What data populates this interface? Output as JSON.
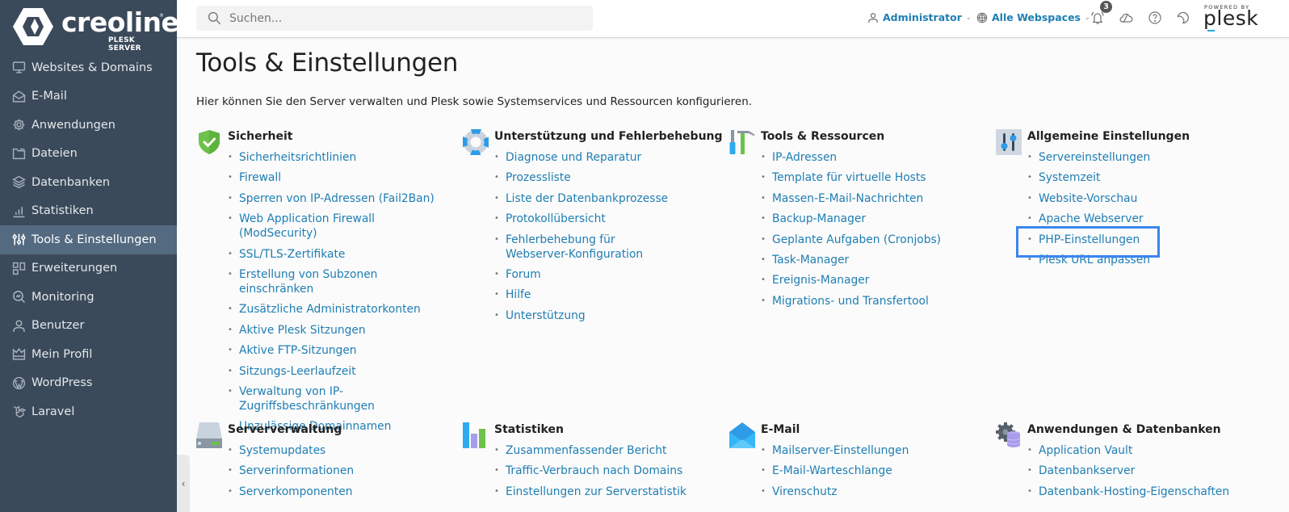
{
  "brand": {
    "name": "creoline",
    "subtitle": "PLESK SERVER",
    "registered": "®"
  },
  "sidebar": {
    "items": [
      {
        "label": "Websites & Domains",
        "icon": "monitor-icon",
        "active": false
      },
      {
        "label": "E-Mail",
        "icon": "mail-open-icon",
        "active": false
      },
      {
        "label": "Anwendungen",
        "icon": "gear-icon",
        "active": false
      },
      {
        "label": "Dateien",
        "icon": "folder-icon",
        "active": false
      },
      {
        "label": "Datenbanken",
        "icon": "layers-icon",
        "active": false
      },
      {
        "label": "Statistiken",
        "icon": "bar-chart-icon",
        "active": false
      },
      {
        "label": "Tools & Einstellungen",
        "icon": "sliders-icon",
        "active": true
      },
      {
        "label": "Erweiterungen",
        "icon": "extensions-icon",
        "active": false
      },
      {
        "label": "Monitoring",
        "icon": "monitoring-icon",
        "active": false
      },
      {
        "label": "Benutzer",
        "icon": "user-icon",
        "active": false
      },
      {
        "label": "Mein Profil",
        "icon": "crown-icon",
        "active": false
      },
      {
        "label": "WordPress",
        "icon": "wordpress-icon",
        "active": false
      },
      {
        "label": "Laravel",
        "icon": "laravel-icon",
        "active": false
      }
    ],
    "collapse_label": "‹"
  },
  "header": {
    "search_placeholder": "Suchen...",
    "user_label": "Administrator",
    "webspace_label": "Alle Webspaces",
    "notification_count": "3",
    "powered_by": "POWERED BY",
    "plesk": "plesk"
  },
  "page": {
    "title": "Tools & Einstellungen",
    "description": "Hier können Sie den Server verwalten und Plesk sowie Systemservices und Ressourcen konfigurieren."
  },
  "groups": [
    {
      "title": "Sicherheit",
      "icon": "shield-check-icon",
      "links": [
        "Sicherheitsrichtlinien",
        "Firewall",
        "Sperren von IP-Adressen (Fail2Ban)",
        "Web Application Firewall (ModSecurity)",
        "SSL/TLS-Zertifikate",
        "Erstellung von Subzonen einschränken",
        "Zusätzliche Administratorkonten",
        "Aktive Plesk Sitzungen",
        "Aktive FTP-Sitzungen",
        "Sitzungs-Leerlaufzeit",
        "Verwaltung von IP-Zugriffsbeschränkungen",
        "Unzulässige Domainnamen"
      ]
    },
    {
      "title": "Unterstützung und Fehlerbehebung",
      "icon": "lifebuoy-icon",
      "links": [
        "Diagnose und Reparatur",
        "Prozessliste",
        "Liste der Datenbankprozesse",
        "Protokollübersicht",
        "Fehlerbehebung für Webserver-Konfiguration",
        "Forum",
        "Hilfe",
        "Unterstützung"
      ]
    },
    {
      "title": "Tools & Ressourcen",
      "icon": "tools-icon",
      "links": [
        "IP-Adressen",
        "Template für virtuelle Hosts",
        "Massen-E-Mail-Nachrichten",
        "Backup-Manager",
        "Geplante Aufgaben (Cronjobs)",
        "Task-Manager",
        "Ereignis-Manager",
        "Migrations- und Transfertool"
      ]
    },
    {
      "title": "Allgemeine Einstellungen",
      "icon": "settings-sliders-icon",
      "links": [
        "Servereinstellungen",
        "Systemzeit",
        "Website-Vorschau",
        "Apache Webserver",
        "PHP-Einstellungen",
        "Plesk URL anpassen"
      ],
      "highlighted_link": "PHP-Einstellungen"
    },
    {
      "title": "Serververwaltung",
      "icon": "server-icon",
      "links": [
        "Systemupdates",
        "Serverinformationen",
        "Serverkomponenten"
      ]
    },
    {
      "title": "Statistiken",
      "icon": "statistics-icon",
      "links": [
        "Zusammenfassender Bericht",
        "Traffic-Verbrauch nach Domains",
        "Einstellungen zur Serverstatistik"
      ]
    },
    {
      "title": "E-Mail",
      "icon": "envelope-icon",
      "links": [
        "Mailserver-Einstellungen",
        "E-Mail-Warteschlange",
        "Virenschutz"
      ]
    },
    {
      "title": "Anwendungen & Datenbanken",
      "icon": "apps-databases-icon",
      "links": [
        "Application Vault",
        "Datenbankserver",
        "Datenbank-Hosting-Eigenschaften"
      ]
    }
  ],
  "colors": {
    "sidebar_bg": "#3b4a5a",
    "sidebar_active": "#536a80",
    "link": "#1f7eb3",
    "highlight": "#3a86f0"
  }
}
